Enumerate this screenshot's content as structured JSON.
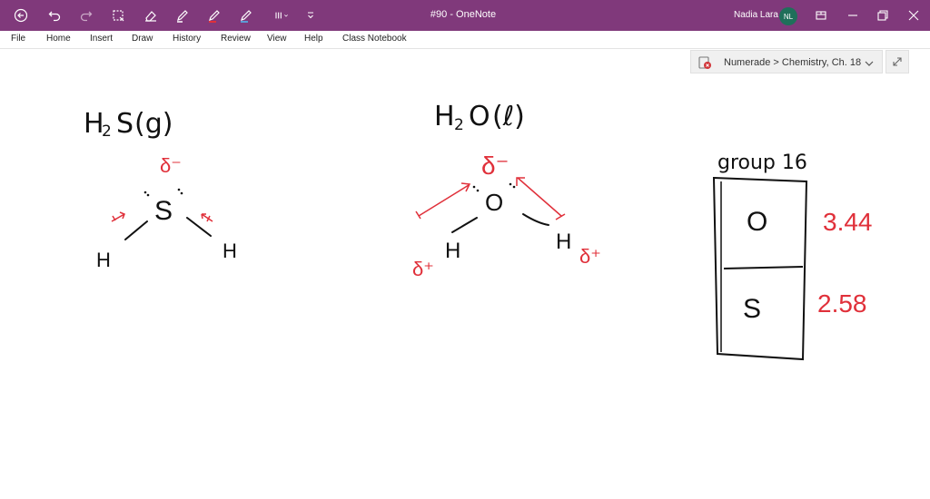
{
  "window": {
    "doc_title": "#90 - OneNote",
    "user_name": "Nadia Lara",
    "user_initials": "NL"
  },
  "toolbar_icons": [
    "back-icon",
    "undo-icon",
    "redo-icon",
    "lasso-icon",
    "eraser-icon",
    "pen-icon",
    "red-pen-icon",
    "highlighter-icon",
    "pen-rack-icon",
    "customize-icon"
  ],
  "menu": {
    "items": [
      "File",
      "Home",
      "Insert",
      "Draw",
      "History",
      "Review",
      "View",
      "Help",
      "Class Notebook"
    ]
  },
  "notebook": {
    "breadcrumb": "Numerade > Chemistry, Ch. 18"
  },
  "accent_color": "#80397b",
  "ink_red": "#e0303a",
  "ink_black": "#111111",
  "note": {
    "h2s": {
      "label_H": "H",
      "label_sub2": "2",
      "label_S": "S",
      "label_state": "(g)",
      "delta": "δ⁻",
      "atom_center": "S",
      "atom_left": "H",
      "atom_right": "H"
    },
    "h2o": {
      "label_H": "H",
      "label_sub2": "2",
      "label_O": "O",
      "label_state": "(ℓ)",
      "delta_top": "δ⁻",
      "atom_center": "O",
      "atom_left": "H",
      "atom_right": "H",
      "delta_left": "δ⁺",
      "delta_right": "δ⁺"
    },
    "group": {
      "heading": "group 16",
      "element_top": "O",
      "element_bottom": "S",
      "value_top": "3.44",
      "value_bottom": "2.58"
    }
  }
}
